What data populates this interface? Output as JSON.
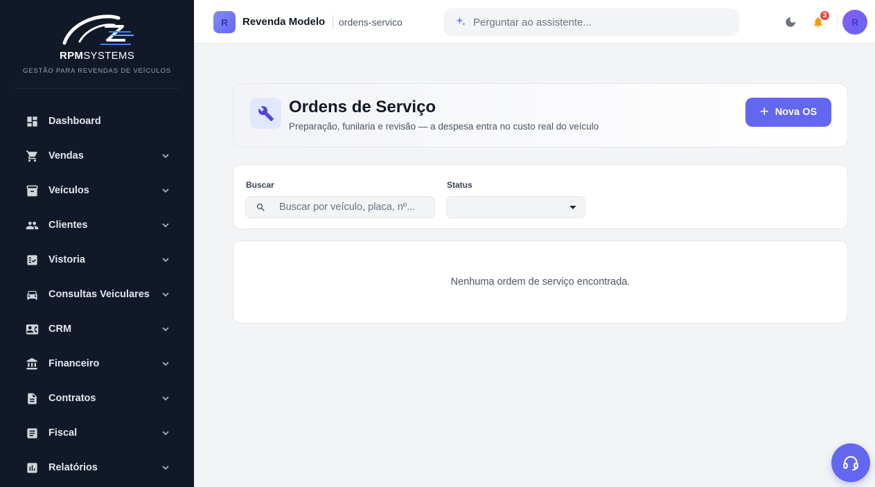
{
  "brand": {
    "name_bold": "RPM",
    "name_light": "SYSTEMS",
    "tagline": "GESTÃO PARA REVENDAS DE VEÍCULOS"
  },
  "sidebar": {
    "items": [
      {
        "label": "Dashboard",
        "icon": "dashboard-icon",
        "expandable": false
      },
      {
        "label": "Vendas",
        "icon": "cart-icon",
        "expandable": true
      },
      {
        "label": "Veículos",
        "icon": "inventory-icon",
        "expandable": true
      },
      {
        "label": "Clientes",
        "icon": "people-icon",
        "expandable": true
      },
      {
        "label": "Vistoria",
        "icon": "checklist-icon",
        "expandable": true
      },
      {
        "label": "Consultas Veiculares",
        "icon": "car-icon",
        "expandable": true
      },
      {
        "label": "CRM",
        "icon": "contact-card-icon",
        "expandable": true
      },
      {
        "label": "Financeiro",
        "icon": "bank-icon",
        "expandable": true
      },
      {
        "label": "Contratos",
        "icon": "document-icon",
        "expandable": true
      },
      {
        "label": "Fiscal",
        "icon": "receipt-icon",
        "expandable": true
      },
      {
        "label": "Relatórios",
        "icon": "bar-chart-icon",
        "expandable": true
      }
    ]
  },
  "topbar": {
    "org_initial": "R",
    "org_name": "Revenda Modelo",
    "breadcrumb": "ordens-servico",
    "assistant_placeholder": "Perguntar ao assistente...",
    "notification_count": "3",
    "user_initial": "R"
  },
  "page": {
    "title": "Ordens de Serviço",
    "subtitle": "Preparação, funilaria e revisão — a despesa entra no custo real do veículo",
    "new_button": "Nova OS"
  },
  "filters": {
    "search_label": "Buscar",
    "search_placeholder": "Buscar por veículo, placa, nº...",
    "status_label": "Status",
    "status_value": ""
  },
  "empty_state": {
    "message": "Nenhuma ordem de serviço encontrada."
  },
  "colors": {
    "accent": "#6366f1",
    "sidebar_bg": "#111827",
    "notification_badge": "#ef4444",
    "bell": "#f59e0b"
  }
}
